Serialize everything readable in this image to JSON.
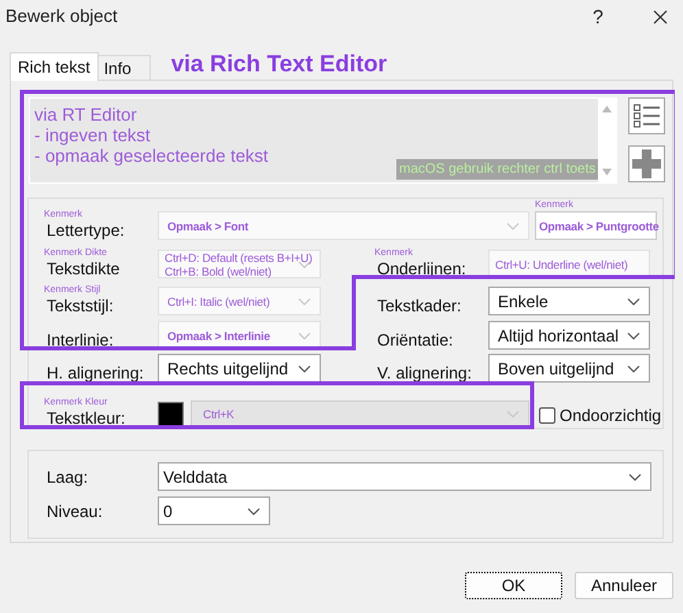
{
  "window": {
    "title": "Bewerk object",
    "help": "?"
  },
  "tabs": [
    {
      "label": "Rich tekst",
      "selected": true
    },
    {
      "label": "Info",
      "selected": false
    }
  ],
  "annotation": "via Rich Text Editor",
  "editor": {
    "lines": [
      "via RT Editor",
      "- ingeven tekst",
      "- opmaak geselecteerde tekst"
    ],
    "hint": "macOS gebruik rechter ctrl toets"
  },
  "rows": [
    {
      "left": {
        "kind": "combo",
        "note": "Kenmerk",
        "label": "Lettertype:",
        "lines": [
          "Opmaak > Font"
        ],
        "hint": true,
        "bold": true
      },
      "right": {
        "kind": "text",
        "note": "Kenmerk",
        "lines": [
          "Opmaak > Puntgrootte"
        ],
        "hint": true,
        "bold": true
      }
    },
    {
      "left": {
        "kind": "combo",
        "note": "Kenmerk Dikte",
        "label": "Tekstdikte",
        "lines": [
          "Ctrl+D: Default (resets B+I+U)",
          "Ctrl+B: Bold (wel/niet)"
        ],
        "hint": true,
        "bold": false
      },
      "right": {
        "kind": "text",
        "note": "Kenmerk",
        "label": "Onderlijnen:",
        "lines": [
          "Ctrl+U: Underline (wel/niet)"
        ],
        "hint": true,
        "bold": false
      }
    },
    {
      "left": {
        "kind": "combo",
        "note": "Kenmerk Stijl",
        "label": "Tekststijl:",
        "lines": [
          "Ctrl+I: Italic (wel/niet)"
        ],
        "hint": true,
        "bold": false
      },
      "right": {
        "kind": "combo",
        "label": "Tekstkader:",
        "lines": [
          "Enkele"
        ],
        "hint": false,
        "bold": false
      }
    },
    {
      "left": {
        "kind": "combo",
        "label": "Interlinie:",
        "lines": [
          "Opmaak > Interlinie"
        ],
        "hint": true,
        "bold": true
      },
      "right": {
        "kind": "combo",
        "label": "Oriëntatie:",
        "lines": [
          "Altijd horizontaal"
        ],
        "hint": false,
        "bold": false
      }
    },
    {
      "left": {
        "kind": "combo",
        "label": "H. alignering:",
        "lines": [
          "Rechts uitgelijnd"
        ],
        "hint": false,
        "bold": false
      },
      "right": {
        "kind": "combo",
        "label": "V. alignering:",
        "lines": [
          "Boven uitgelijnd"
        ],
        "hint": false,
        "bold": false
      }
    },
    {
      "left": {
        "kind": "color",
        "note": "Kenmerk Kleur",
        "label": "Tekstkleur:",
        "color": "#000000",
        "lines": [
          "Ctrl+K"
        ],
        "hint": true,
        "bold": false
      },
      "right": {
        "kind": "checkbox",
        "label": "Ondoorzichtig",
        "checked": false
      }
    }
  ],
  "layer": [
    {
      "label": "Laag:",
      "value": "Velddata"
    },
    {
      "label": "Niveau:",
      "value": "0"
    }
  ],
  "buttons": [
    {
      "label": "OK",
      "focused": true
    },
    {
      "label": "Annuleer",
      "focused": false
    }
  ]
}
